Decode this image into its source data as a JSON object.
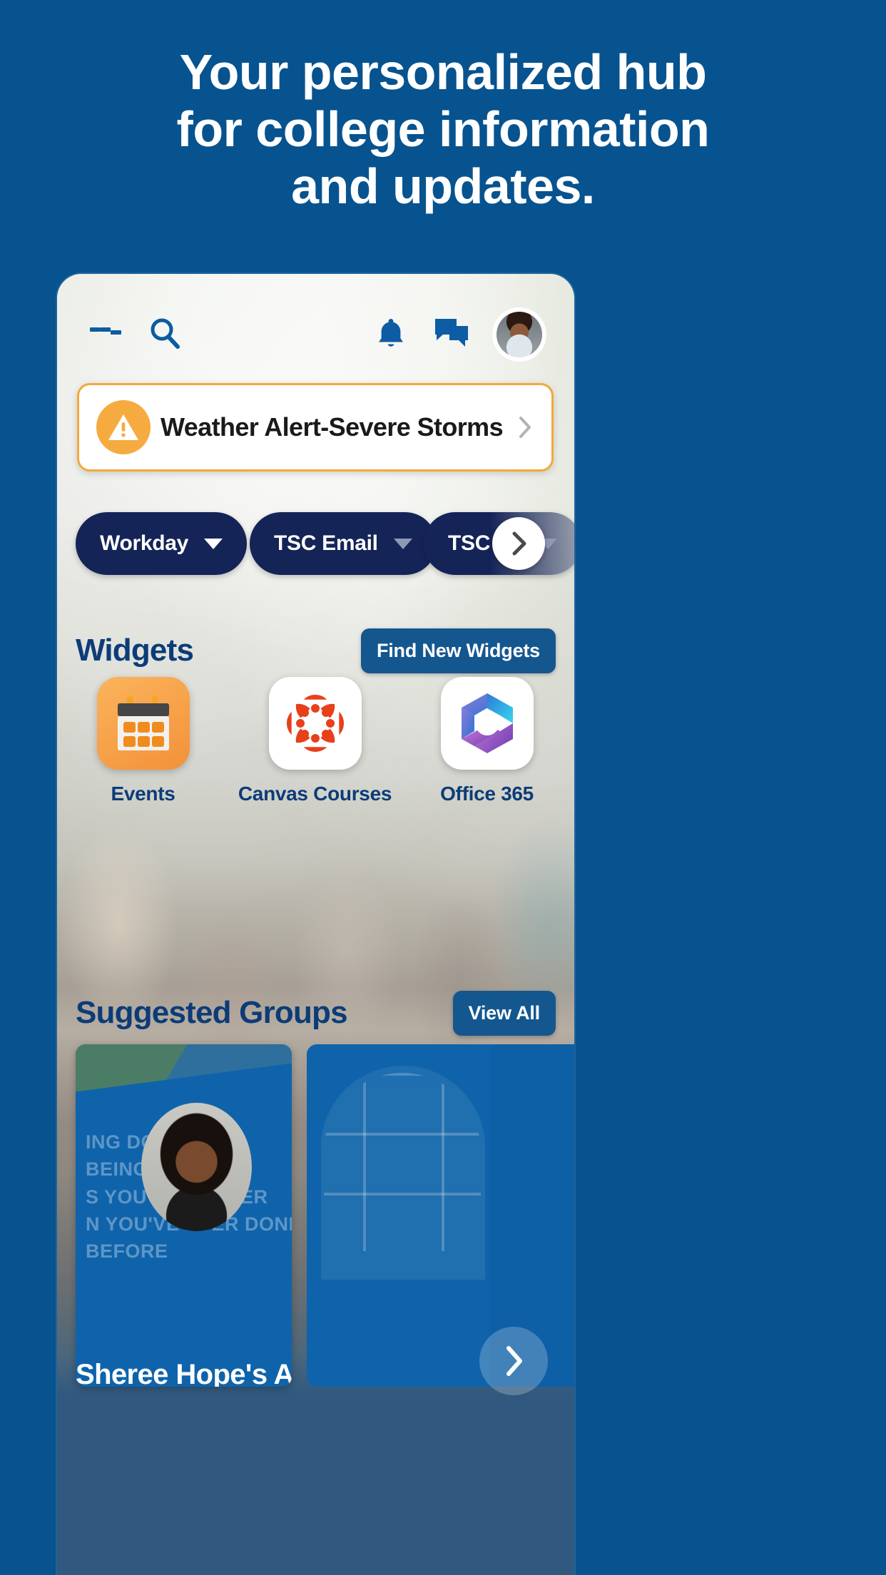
{
  "hero": {
    "lines": [
      "Your personalized hub",
      "for college information",
      "and updates."
    ]
  },
  "colors": {
    "brand_blue": "#07538f",
    "navy": "#152457",
    "accent_orange": "#f6ab41",
    "button_blue": "#14578f",
    "heading_blue": "#0c3c78"
  },
  "appbar": {
    "menu_icon": "hamburger-menu-icon",
    "search_icon": "search-icon",
    "notifications_icon": "bell-icon",
    "messages_icon": "chat-bubble-icon",
    "avatar": "user-avatar"
  },
  "alert": {
    "icon": "warning-triangle-icon",
    "title": "Weather Alert-Severe Storms",
    "chevron": "chevron-right-icon"
  },
  "chips": [
    {
      "label": "Workday",
      "caret": "chevron-down-icon"
    },
    {
      "label": "TSC Email",
      "caret": "chevron-down-icon"
    },
    {
      "label": "TSC Ca",
      "caret": "chevron-down-icon"
    }
  ],
  "chips_next_icon": "chevron-right-icon",
  "widgets_section": {
    "title": "Widgets",
    "action_label": "Find New Widgets",
    "items": [
      {
        "label": "Events",
        "icon": "calendar-icon"
      },
      {
        "label": "Canvas Courses",
        "icon": "canvas-logo-icon"
      },
      {
        "label": "Office 365",
        "icon": "office-365-logo-icon"
      }
    ]
  },
  "groups_section": {
    "title": "Suggested Groups",
    "action_label": "View All",
    "cards": [
      {
        "quote_lines": [
          "ING DOESN'T",
          "BEING FIRST.",
          "S YOU'RE DOIN       ER",
          "N YOU'VE EVER DONE",
          "BEFORE"
        ],
        "name": "Sheree Hope's Advising"
      }
    ],
    "next_icon": "chevron-right-icon"
  }
}
